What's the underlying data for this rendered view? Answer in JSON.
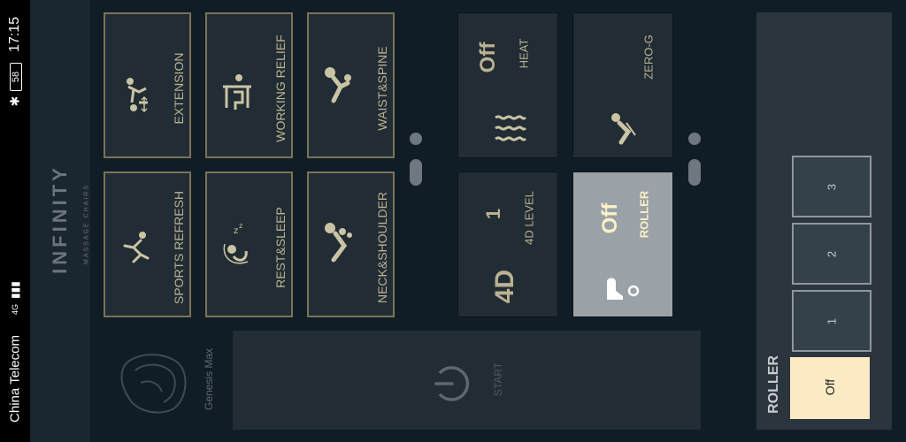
{
  "status_bar": {
    "time": "17:15",
    "battery": "58",
    "carrier": "China Telecom",
    "network": "4G"
  },
  "brand": {
    "name": "INFINITY",
    "tagline": "MASSAGE CHAIRS",
    "model": "Genesis Max"
  },
  "modes": [
    {
      "label": "EXTENSION",
      "icon": "stretch-figure-icon"
    },
    {
      "label": "WORKING RELIEF",
      "icon": "desk-worker-icon"
    },
    {
      "label": "WAIST&SPINE",
      "icon": "reclined-figure-icon"
    },
    {
      "label": "SPORTS REFRESH",
      "icon": "running-figure-icon"
    },
    {
      "label": "REST&SLEEP",
      "icon": "sleeping-figure-icon"
    },
    {
      "label": "NECK&SHOULDER",
      "icon": "neck-figure-icon"
    }
  ],
  "functions": {
    "heat": {
      "value": "Off",
      "label": "HEAT"
    },
    "zero_g": {
      "label": "ZERO-G"
    },
    "level_4d": {
      "value": "1",
      "label": "4D LEVEL",
      "badge": "4D"
    },
    "roller": {
      "value": "Off",
      "label": "ROLLER"
    }
  },
  "start": {
    "label": "START"
  },
  "roller_panel": {
    "title": "ROLLER",
    "options": [
      "3",
      "2",
      "1",
      "Off"
    ],
    "selected": "Off"
  },
  "colors": {
    "background": "#111d26",
    "tile": "#222c35",
    "tile_border": "#7b7257",
    "active_tile": "#9aa2a8",
    "selected_option": "#fcebc4"
  }
}
